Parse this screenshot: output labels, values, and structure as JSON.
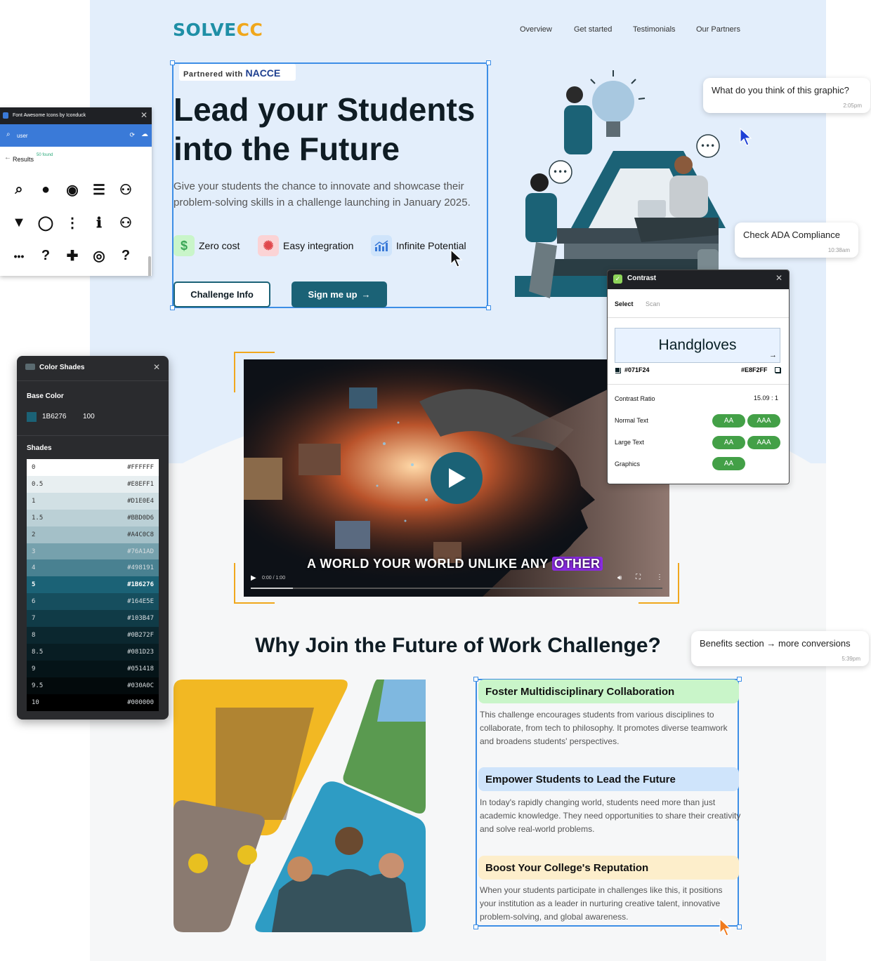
{
  "nav": {
    "logo_main": "SOLVE",
    "logo_cc": "CC",
    "items": [
      "Overview",
      "Get started",
      "Testimonials",
      "Our Partners"
    ]
  },
  "hero": {
    "partner_prefix": "Partnered with",
    "partner_name": "NACCE",
    "title_line1": "Lead your Students",
    "title_line2": "into the Future",
    "subtitle": "Give your students the chance to innovate and showcase their problem-solving skills in a challenge launching in January 2025.",
    "features": [
      {
        "label": "Zero cost",
        "icon": "dollar-icon",
        "color": "#3aa655"
      },
      {
        "label": "Easy integration",
        "icon": "gear-icon",
        "color": "#e0474c"
      },
      {
        "label": "Infinite Potential",
        "icon": "chart-up-icon",
        "color": "#3a7ad8"
      }
    ],
    "btn_info": "Challenge Info",
    "btn_signup": "Sign me up"
  },
  "video": {
    "caption_main": "A WORLD YOUR WORLD UNLIKE ANY",
    "caption_highlight": "OTHER",
    "time": "0:00 / 1:00"
  },
  "why": {
    "title": "Why Join the Future of Work Challenge?",
    "benefits": [
      {
        "heading": "Foster Multidisciplinary Collaboration",
        "color": "#c9f5c9",
        "text": "This challenge encourages students from various disciplines to collaborate, from tech to philosophy. It promotes diverse teamwork and broadens students' perspectives."
      },
      {
        "heading": "Empower Students to Lead the Future",
        "color": "#cfe4fb",
        "text": "In today's rapidly changing world, students need more than just academic knowledge. They need opportunities to share their creativity and solve real-world problems."
      },
      {
        "heading": "Boost Your College's Reputation",
        "color": "#fdeecb",
        "text": "When your students participate in challenges like this, it positions your institution as a leader in nurturing creative talent, innovative problem-solving, and global awareness."
      }
    ]
  },
  "fa_panel": {
    "title": "Font Awesome Icons by Iconduck",
    "search_value": "user",
    "results_label": "Results",
    "found": "50 found",
    "icons": [
      "search-icon",
      "user-icon",
      "user-circle-icon",
      "bars-icon",
      "users-icon",
      "caret-down-icon",
      "user-outline-icon",
      "ellipsis-vertical-icon",
      "info-circle-icon",
      "user-friends-icon",
      "ellipsis-icon",
      "question-circle-icon",
      "user-plus-icon",
      "user-circle-outline-icon",
      "question-icon"
    ],
    "glyphs": [
      "⌕",
      "●",
      "◉",
      "☰",
      "⚇",
      "▼",
      "◯",
      "⋮",
      "ℹ",
      "⚇",
      "•••",
      "?",
      "✚",
      "◎",
      "?"
    ]
  },
  "shades": {
    "title": "Color Shades",
    "base_label": "Base Color",
    "base_hex": "1B6276",
    "base_value": "100",
    "base_color": "#1B6276",
    "shades_label": "Shades",
    "rows": [
      {
        "k": "0",
        "hex": "#FFFFFF"
      },
      {
        "k": "0.5",
        "hex": "#E8EFF1"
      },
      {
        "k": "1",
        "hex": "#D1E0E4"
      },
      {
        "k": "1.5",
        "hex": "#BBD0D6"
      },
      {
        "k": "2",
        "hex": "#A4C0C8"
      },
      {
        "k": "3",
        "hex": "#76A1AD"
      },
      {
        "k": "4",
        "hex": "#498191"
      },
      {
        "k": "5",
        "hex": "#1B6276"
      },
      {
        "k": "6",
        "hex": "#164E5E"
      },
      {
        "k": "7",
        "hex": "#103B47"
      },
      {
        "k": "8",
        "hex": "#0B272F"
      },
      {
        "k": "8.5",
        "hex": "#081D23"
      },
      {
        "k": "9",
        "hex": "#051418"
      },
      {
        "k": "9.5",
        "hex": "#030A0C"
      },
      {
        "k": "10",
        "hex": "#000000"
      }
    ]
  },
  "contrast": {
    "title": "Contrast",
    "tab_select": "Select",
    "tab_scan": "Scan",
    "preview_text": "Handgloves",
    "fg": "#071F24",
    "bg": "#E8F2FF",
    "ratio_label": "Contrast Ratio",
    "ratio_value": "15.09 : 1",
    "rows": [
      {
        "label": "Normal Text",
        "pills": [
          "AA",
          "AAA"
        ]
      },
      {
        "label": "Large Text",
        "pills": [
          "AA",
          "AAA"
        ]
      },
      {
        "label": "Graphics",
        "pills": [
          "AA"
        ]
      }
    ]
  },
  "comments": [
    {
      "text": "What do you think of this graphic?",
      "time": "2:05pm"
    },
    {
      "text": "Check ADA Compliance",
      "time": "10:38am"
    },
    {
      "text": "Benefits section → more conversions",
      "time": "5:39pm"
    }
  ]
}
